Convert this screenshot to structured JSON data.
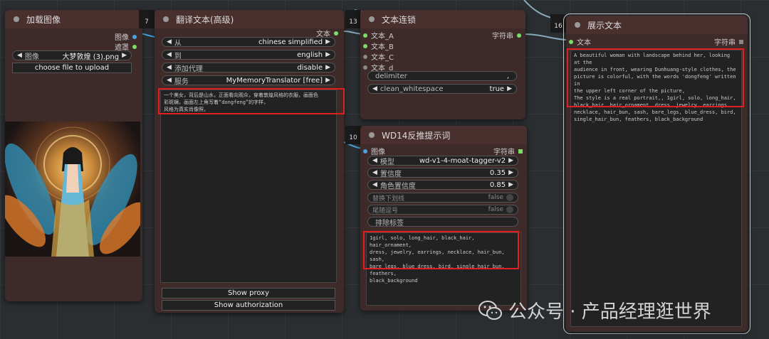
{
  "nodes": {
    "load_image": {
      "title": "加载图像",
      "outputs": [
        "图像",
        "遮罩"
      ],
      "image_widget": {
        "label": "图像",
        "value": "大梦敦煌 (3).png"
      },
      "upload_button": "choose file to upload"
    },
    "translate": {
      "id": "7",
      "title": "翻译文本(高级)",
      "output": "文本",
      "widgets": [
        {
          "label": "从",
          "value": "chinese simplified"
        },
        {
          "label": "到",
          "value": "english"
        },
        {
          "label": "添加代理",
          "value": "disable"
        },
        {
          "label": "服务",
          "value": "MyMemoryTranslator [free]"
        }
      ],
      "text": "一个美女，背后是山水，正面看向观众，穿着敦煌风格的衣服，画面色\n彩斑斓，画面左上角写着“dongfeng”的字样，\n风格为真实肖像照，",
      "buttons": [
        "Show proxy",
        "Show authorization"
      ]
    },
    "concat": {
      "id": "13",
      "title": "文本连锁",
      "inputs": [
        "文本_A",
        "文本_B",
        "文本_C",
        "文本_d"
      ],
      "output": "字符串",
      "delimiter": {
        "label": "delimiter",
        "value": ","
      },
      "clean": {
        "label": "clean_whitespace",
        "value": "true"
      }
    },
    "wd14": {
      "id": "10",
      "title": "WD14反推提示词",
      "input": "图像",
      "output": "字符串",
      "widgets": [
        {
          "label": "模型",
          "value": "wd-v1-4-moat-tagger-v2"
        },
        {
          "label": "置信度",
          "value": "0.35"
        },
        {
          "label": "角色置信度",
          "value": "0.85"
        }
      ],
      "toggles": [
        {
          "label": "替换下划线",
          "value": "false"
        },
        {
          "label": "尾随逗号",
          "value": "false"
        }
      ],
      "exclude_label": "排除标签",
      "text": "1girl, solo, long_hair, black_hair, hair_ornament,\ndress, jewelry, earrings, necklace, hair_bun, sash,\nbare_legs, blue_dress, bird, single_hair_bun, feathers,\nblack_background"
    },
    "show_text": {
      "id": "16",
      "title": "展示文本",
      "input": "文本",
      "output": "字符串",
      "text": "A beautiful woman with landscape behind her, looking at the\naudience in front, wearing Dunhuang-style clothes, the\npicture is colorful, with the words 'dongfeng' written in\nthe upper left corner of the picture,\nThe style is a real portrait,, 1girl, solo, long_hair,\nblack_hair, hair_ornament, dress, jewelry, earrings,\nnecklace, hair_bun, sash, bare_legs, blue_dress, bird,\nsingle_hair_bun, feathers, black_background"
    }
  },
  "watermark": "公众号 · 产品经理逛世界",
  "colors": {
    "node_bg": "#3f2a2a",
    "title_bg": "#4a2f2f",
    "highlight": "#e02020",
    "link_blue": "#4aa3df",
    "slot_green": "#7cdd66"
  }
}
